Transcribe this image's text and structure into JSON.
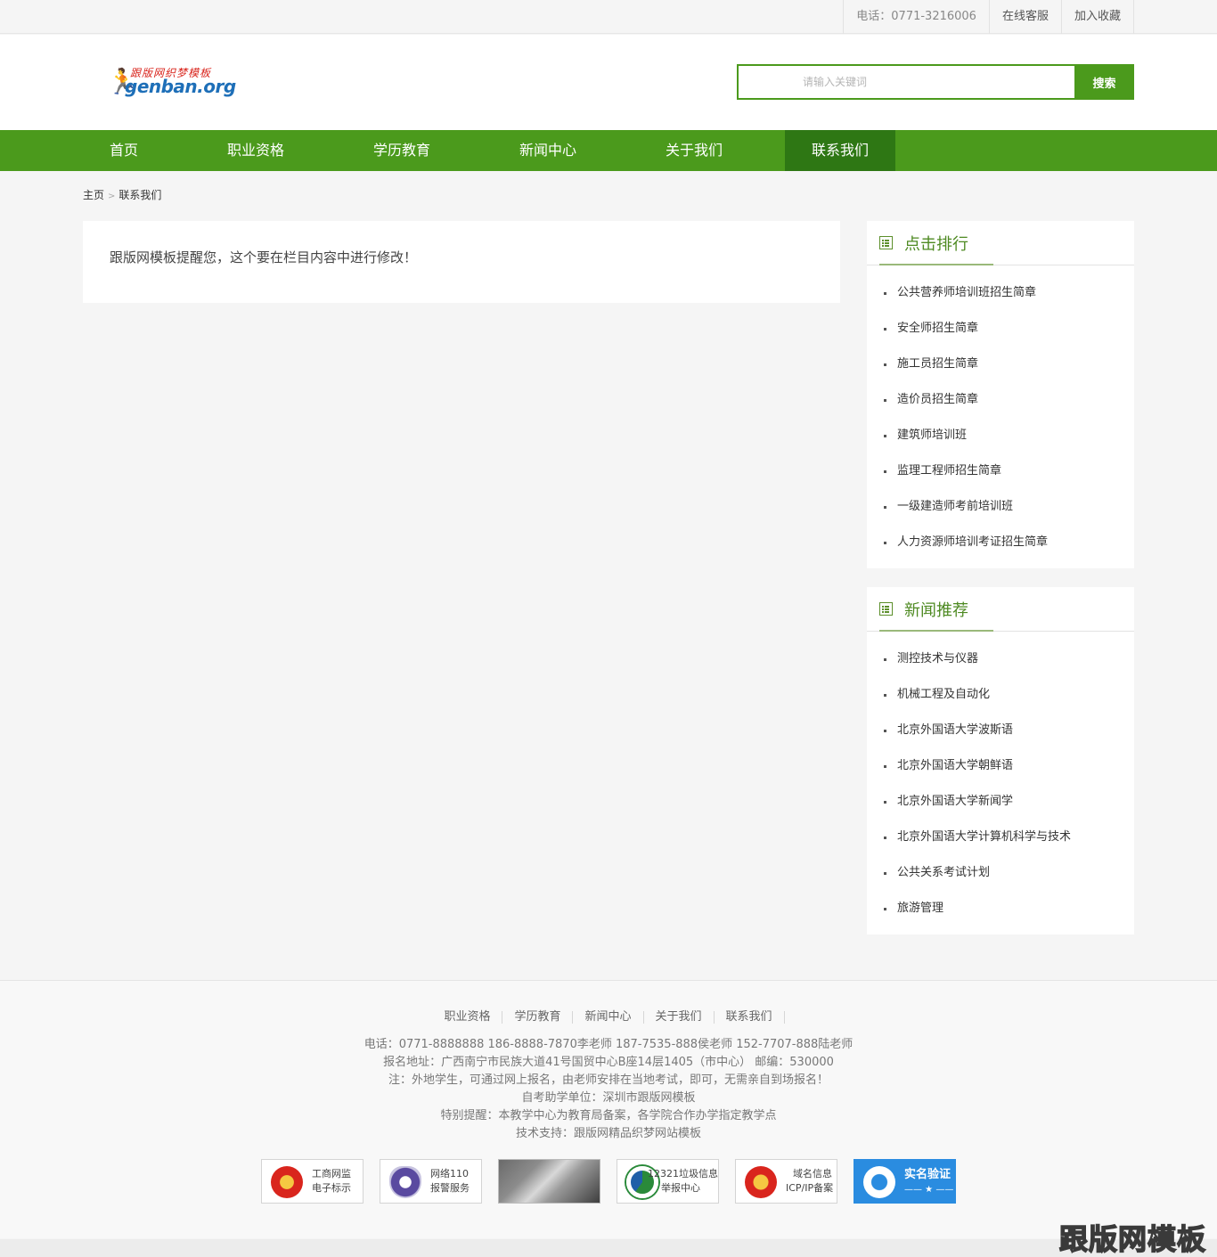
{
  "topbar": {
    "phone": "电话：0771-3216006",
    "service": "在线客服",
    "favorite": "加入收藏"
  },
  "header": {
    "logo_top": "跟版网织梦模板",
    "logo_text": "genban.org",
    "search_placeholder": "请输入关键词",
    "search_button": "搜索"
  },
  "nav": {
    "items": [
      {
        "label": "首页"
      },
      {
        "label": "职业资格"
      },
      {
        "label": "学历教育"
      },
      {
        "label": "新闻中心"
      },
      {
        "label": "关于我们"
      },
      {
        "label": "联系我们",
        "active": true
      }
    ],
    "color": "#4b9a1c",
    "active_color": "#2e7714"
  },
  "breadcrumb": {
    "home": "主页",
    "sep": ">",
    "current": "联系我们"
  },
  "content": {
    "text": "跟版网模板提醒您，这个要在栏目内容中进行修改！"
  },
  "sidebar": {
    "ranking": {
      "title": "点击排行",
      "items": [
        "公共营养师培训班招生简章",
        "安全师招生简章",
        "施工员招生简章",
        "造价员招生简章",
        "建筑师培训班",
        "监理工程师招生简章",
        "一级建造师考前培训班",
        "人力资源师培训考证招生简章"
      ]
    },
    "news": {
      "title": "新闻推荐",
      "items": [
        "测控技术与仪器",
        "机械工程及自动化",
        "北京外国语大学波斯语",
        "北京外国语大学朝鲜语",
        "北京外国语大学新闻学",
        "北京外国语大学计算机科学与技术",
        "公共关系考试计划",
        "旅游管理"
      ]
    }
  },
  "footer": {
    "links": [
      "职业资格",
      "学历教育",
      "新闻中心",
      "关于我们",
      "联系我们"
    ],
    "lines": [
      "电话：0771-8888888 186-8888-7870李老师 187-7535-888侯老师 152-7707-888陆老师",
      "报名地址：广西南宁市民族大道41号国贸中心B座14层1405（市中心） 邮编：530000",
      "注：外地学生，可通过网上报名，由老师安排在当地考试，即可，无需亲自到场报名！",
      "自考助学单位：深圳市跟版网模板",
      "特别提醒：本教学中心为教育局备案，各学院合作办学指定教学点",
      "技术支持：跟版网精品织梦网站模板"
    ],
    "badges": [
      {
        "line1": "工商网监",
        "line2": "电子标示",
        "icon": "police-emblem-icon"
      },
      {
        "line1": "网络110",
        "line2": "报警服务",
        "icon": "police-shield-icon"
      },
      {
        "line1": "",
        "line2": "",
        "icon": "photo"
      },
      {
        "line1": "12321垃圾信息",
        "line2": "举报中心",
        "icon": "report-center-icon"
      },
      {
        "line1": "域名信息",
        "line2": "ICP/IP备案",
        "icon": "icp-emblem-icon"
      },
      {
        "line1": "实名验证",
        "line2": "—— ★ ——",
        "icon": "verify-v-icon"
      }
    ]
  },
  "watermark": "跟版网模板"
}
